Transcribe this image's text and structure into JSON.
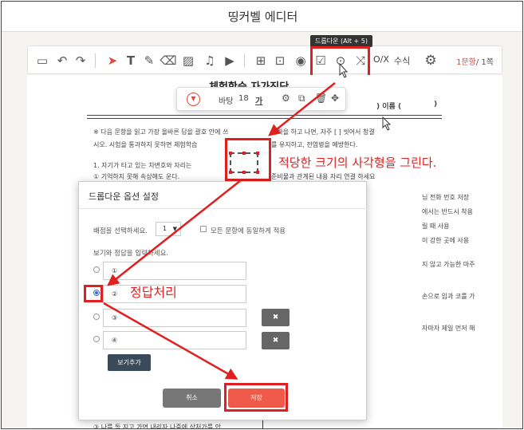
{
  "app": {
    "title": "띵커벨 에디터"
  },
  "toolbar": {
    "tooltip": "드롭다운 (Alt + 5)",
    "ox_label": "O/X",
    "formula_label": "수식",
    "page_current": "1문항",
    "page_total": "/ 1쪽",
    "icons": [
      "textbox-icon",
      "undo-icon",
      "redo-icon",
      "pointer-icon",
      "text-icon",
      "pen-icon",
      "eraser-icon",
      "image-add-icon",
      "music-icon",
      "video-icon",
      "shape-icon",
      "textbox-frame-icon",
      "record-icon",
      "checkbox-icon",
      "dropdown-icon",
      "shuffle-icon",
      "settings-icon"
    ]
  },
  "floatbar": {
    "background_label": "바탕",
    "font_size": "18",
    "text_char": "가"
  },
  "document": {
    "title": "체험학습 자가진단",
    "name_field": ") 이름 (",
    "name_close": ")",
    "lines": [
      "※ 다음 문항을 읽고 가장 올바른 답을 괄호 안에 쓰",
      "시오. 시험을 통과하지 못하면 체험학습",
      "1. 자기가 타고 있는 차변호와 자리는",
      "① 기억하지 못해 속상해도 운다."
    ],
    "right_lines": [
      "재화을 하고 나면, 자주 [          ] 씻어서 청결",
      "를 유지하고, 전염병을 예방한다.",
      "준비물과 관계된 내용 자리 연결 하세요",
      "님 전화 번호 저장",
      "에서는 반드시 착용",
      "릴 때 사용",
      "이 강한 곳에 사용",
      "지 않고 가능한 마주",
      "손으로 입과 코를 가",
      "자마자 제일 먼저 해"
    ],
    "bottom_line": "③ 나를 돌 지고 가면 내리자 나중에 상처가를 안"
  },
  "annotations": {
    "draw_shape": "적당한 크기의 사각형을 그린다.",
    "correct_answer": "정답처리"
  },
  "dialog": {
    "title": "드롭다운 옵션 설정",
    "score_label": "배점을 선택하세요.",
    "score_value": "1",
    "same_score_label": "모든 문항에 동일하게 적용",
    "options_label": "보기와 정답을 입력하세요.",
    "options": [
      {
        "label": "①",
        "selected": false
      },
      {
        "label": "②",
        "selected": true
      },
      {
        "label": "③",
        "selected": false
      },
      {
        "label": "④",
        "selected": false
      }
    ],
    "delete_symbol": "✖",
    "add_button": "보기추가",
    "cancel_button": "취소",
    "save_button": "저장"
  },
  "colors": {
    "accent": "#e04a3a",
    "highlight": "#e02020",
    "radio_selected": "#3a6fd8"
  }
}
